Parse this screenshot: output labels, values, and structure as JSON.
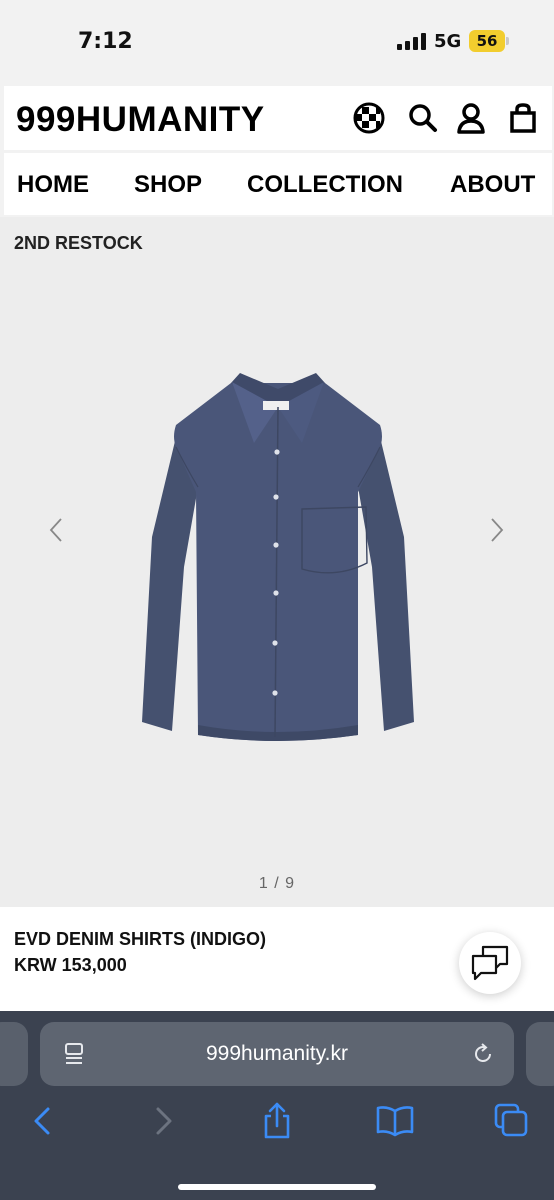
{
  "status_bar": {
    "time": "7:12",
    "network": "5G",
    "battery": "56"
  },
  "site": {
    "logo": "999HUMANITY",
    "icons": [
      "globe-icon",
      "search-icon",
      "user-icon",
      "bag-icon"
    ],
    "nav": [
      "HOME",
      "SHOP",
      "COLLECTION",
      "ABOUT"
    ]
  },
  "product": {
    "tag": "2ND RESTOCK",
    "pager": "1 / 9",
    "name": "EVD DENIM SHIRTS (INDIGO)",
    "price": "KRW 153,000",
    "label_text": "999HUMANITY"
  },
  "browser": {
    "url": "999humanity.kr",
    "toolbar": [
      "back-icon",
      "forward-icon",
      "share-icon",
      "bookmarks-icon",
      "tabs-icon"
    ]
  },
  "colors": {
    "accent": "#3b8bf5",
    "battery": "#f2cd2e",
    "browser_bg": "#3b4250",
    "shirt": "#4a5679"
  }
}
